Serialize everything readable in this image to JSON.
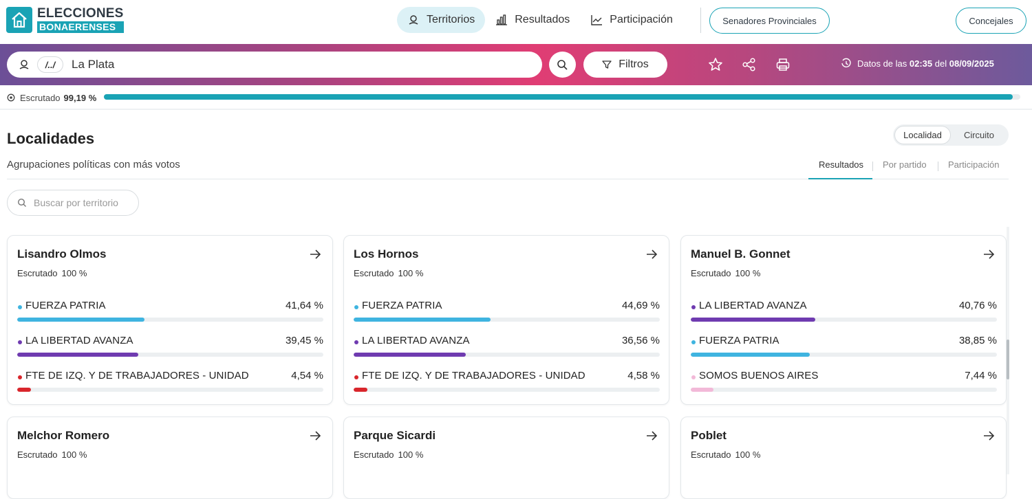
{
  "logo": {
    "line1": "ELECCIONES",
    "line2": "BONAERENSES"
  },
  "nav": {
    "territorios": "Territorios",
    "resultados": "Resultados",
    "participacion": "Participación",
    "senadores": "Senadores Provinciales",
    "concejales": "Concejales"
  },
  "searchbar": {
    "chip": "/../",
    "value": "La Plata",
    "filtros": "Filtros",
    "datos_prefix": "Datos de las",
    "datos_time": "02:35",
    "datos_mid": "del",
    "datos_date": "08/09/2025"
  },
  "escrutado": {
    "label": "Escrutado",
    "value": "99,19 %",
    "fraction": 0.9919
  },
  "section": {
    "title": "Localidades",
    "subtitle": "Agrupaciones políticas con más votos",
    "toggle": [
      "Localidad",
      "Circuito"
    ],
    "tabs": [
      "Resultados",
      "Por partido",
      "Participación"
    ],
    "search_placeholder": "Buscar por territorio"
  },
  "colors": {
    "fuerza_patria": "#3fb4e0",
    "libertad_avanza": "#6f3bb0",
    "fit": "#d9262c",
    "somos": "#f2b9d8",
    "accent": "#1aa3b5"
  },
  "cards": [
    {
      "name": "Lisandro Olmos",
      "esc_label": "Escrutado",
      "esc_value": "100 %",
      "parties": [
        {
          "name": "FUERZA PATRIA",
          "pct": "41,64 %",
          "value": 41.64,
          "color": "#3fb4e0"
        },
        {
          "name": "LA LIBERTAD AVANZA",
          "pct": "39,45 %",
          "value": 39.45,
          "color": "#6f3bb0"
        },
        {
          "name": "FTE DE IZQ. Y DE TRABAJADORES - UNIDAD",
          "pct": "4,54 %",
          "value": 4.54,
          "color": "#d9262c"
        }
      ]
    },
    {
      "name": "Los Hornos",
      "esc_label": "Escrutado",
      "esc_value": "100 %",
      "parties": [
        {
          "name": "FUERZA PATRIA",
          "pct": "44,69 %",
          "value": 44.69,
          "color": "#3fb4e0"
        },
        {
          "name": "LA LIBERTAD AVANZA",
          "pct": "36,56 %",
          "value": 36.56,
          "color": "#6f3bb0"
        },
        {
          "name": "FTE DE IZQ. Y DE TRABAJADORES - UNIDAD",
          "pct": "4,58 %",
          "value": 4.58,
          "color": "#d9262c"
        }
      ]
    },
    {
      "name": "Manuel B. Gonnet",
      "esc_label": "Escrutado",
      "esc_value": "100 %",
      "parties": [
        {
          "name": "LA LIBERTAD AVANZA",
          "pct": "40,76 %",
          "value": 40.76,
          "color": "#6f3bb0"
        },
        {
          "name": "FUERZA PATRIA",
          "pct": "38,85 %",
          "value": 38.85,
          "color": "#3fb4e0"
        },
        {
          "name": "SOMOS BUENOS AIRES",
          "pct": "7,44 %",
          "value": 7.44,
          "color": "#f2b9d8"
        }
      ]
    },
    {
      "name": "Melchor Romero",
      "esc_label": "Escrutado",
      "esc_value": "100 %",
      "parties": []
    },
    {
      "name": "Parque Sicardi",
      "esc_label": "Escrutado",
      "esc_value": "100 %",
      "parties": []
    },
    {
      "name": "Poblet",
      "esc_label": "Escrutado",
      "esc_value": "100 %",
      "parties": []
    }
  ]
}
